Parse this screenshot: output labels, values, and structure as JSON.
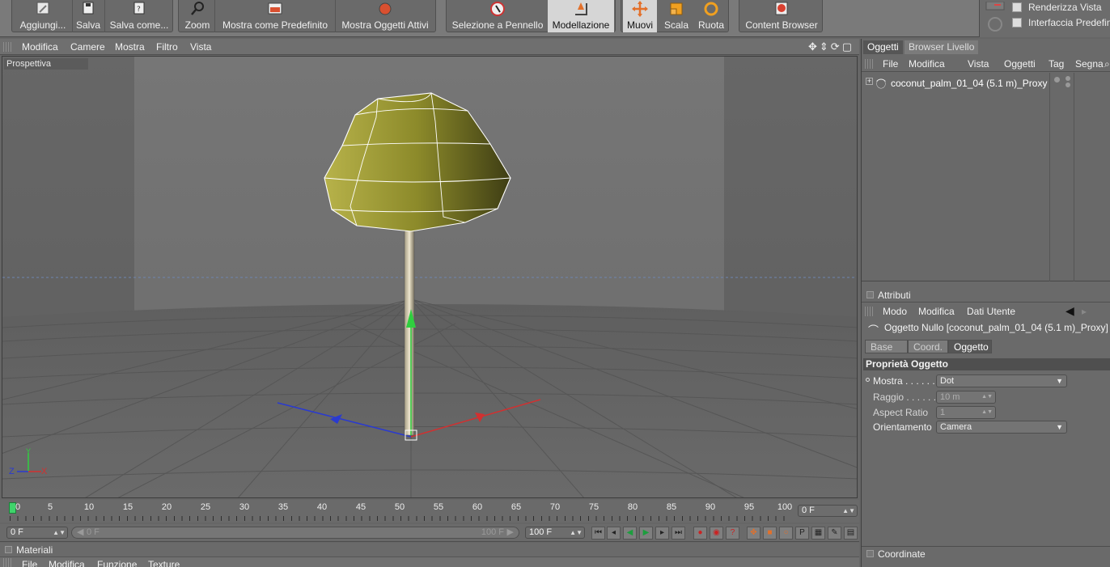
{
  "toolbar": {
    "buttons": [
      {
        "label": "Aggiungi..."
      },
      {
        "label": "Salva"
      },
      {
        "label": "Salva come..."
      },
      {
        "label": "Zoom"
      },
      {
        "label": "Mostra come Predefinito"
      },
      {
        "label": "Mostra Oggetti Attivi"
      },
      {
        "label": "Selezione a Pennello"
      },
      {
        "label": "Modellazione"
      },
      {
        "label": "Muovi"
      },
      {
        "label": "Scala"
      },
      {
        "label": "Ruota"
      },
      {
        "label": "Content Browser"
      }
    ],
    "right_items": [
      "Renderizza Vista",
      "Interfaccia Predefin"
    ]
  },
  "viewport": {
    "menu": [
      "Modifica",
      "Camere",
      "Mostra",
      "Filtro",
      "Vista"
    ],
    "label": "Prospettiva",
    "icons": [
      "move-view-icon",
      "dolly-icon",
      "rotate-view-icon",
      "maximize-icon"
    ],
    "axis_labels": {
      "y": "Y",
      "z": "Z",
      "x": "X"
    }
  },
  "timeline": {
    "ticks": [
      "0",
      "5",
      "10",
      "15",
      "20",
      "25",
      "30",
      "35",
      "40",
      "45",
      "50",
      "55",
      "60",
      "65",
      "70",
      "75",
      "80",
      "85",
      "90",
      "95",
      "100"
    ],
    "current_frame": "0 F",
    "start_frame": "0 F",
    "scrub_start": "0 F",
    "scrub_end": "100 F",
    "end_frame": "100 F"
  },
  "materials": {
    "title": "Materiali",
    "menu": [
      "File",
      "Modifica",
      "Funzione",
      "Texture"
    ]
  },
  "objects_panel": {
    "tabs": [
      "Oggetti",
      "Browser Livello"
    ],
    "menu": [
      "File",
      "Modifica",
      "Vista",
      "Oggetti",
      "Tag",
      "Segna"
    ],
    "object_name": "coconut_palm_01_04 (5.1 m)_Proxy"
  },
  "attributes_panel": {
    "title": "Attributi",
    "menu": [
      "Modo",
      "Modifica",
      "Dati Utente"
    ],
    "object_title": "Oggetto Nullo [coconut_palm_01_04 (5.1 m)_Proxy]",
    "tabs": [
      "Base",
      "Coord.",
      "Oggetto"
    ],
    "section": "Proprietà Oggetto",
    "props": [
      {
        "label": "Mostra . . . . . .",
        "value": "Dot"
      },
      {
        "label": "Raggio . . . . . .",
        "value": "10 m"
      },
      {
        "label": "Aspect Ratio",
        "value": "1"
      },
      {
        "label": "Orientamento",
        "value": "Camera"
      }
    ]
  },
  "coordinates_panel": {
    "title": "Coordinate"
  },
  "colors": {
    "foliage": "#8c8a2a",
    "axis_x": "#d23030",
    "axis_y": "#2fcf3f",
    "axis_z": "#2a3ad0",
    "playhead": "#3fd46b"
  }
}
